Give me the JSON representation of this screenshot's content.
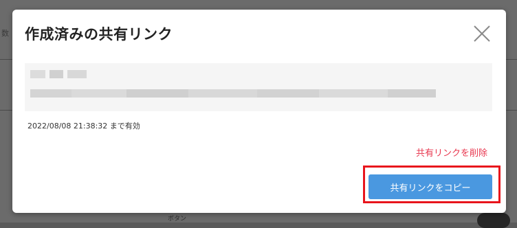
{
  "dialog": {
    "title": "作成済みの共有リンク",
    "close_icon": "close-icon",
    "expiry_text": "2022/08/08 21:38:32 まで有効",
    "delete_label": "共有リンクを削除",
    "copy_label": "共有リンクをコピー"
  },
  "background": {
    "fragment_text": "数",
    "bottom_text": "ボタン"
  },
  "colors": {
    "title": "#222222",
    "delete_link": "#e8374f",
    "copy_button": "#4a98e0",
    "highlight": "#e8141c",
    "link_box": "#f5f5f5"
  }
}
